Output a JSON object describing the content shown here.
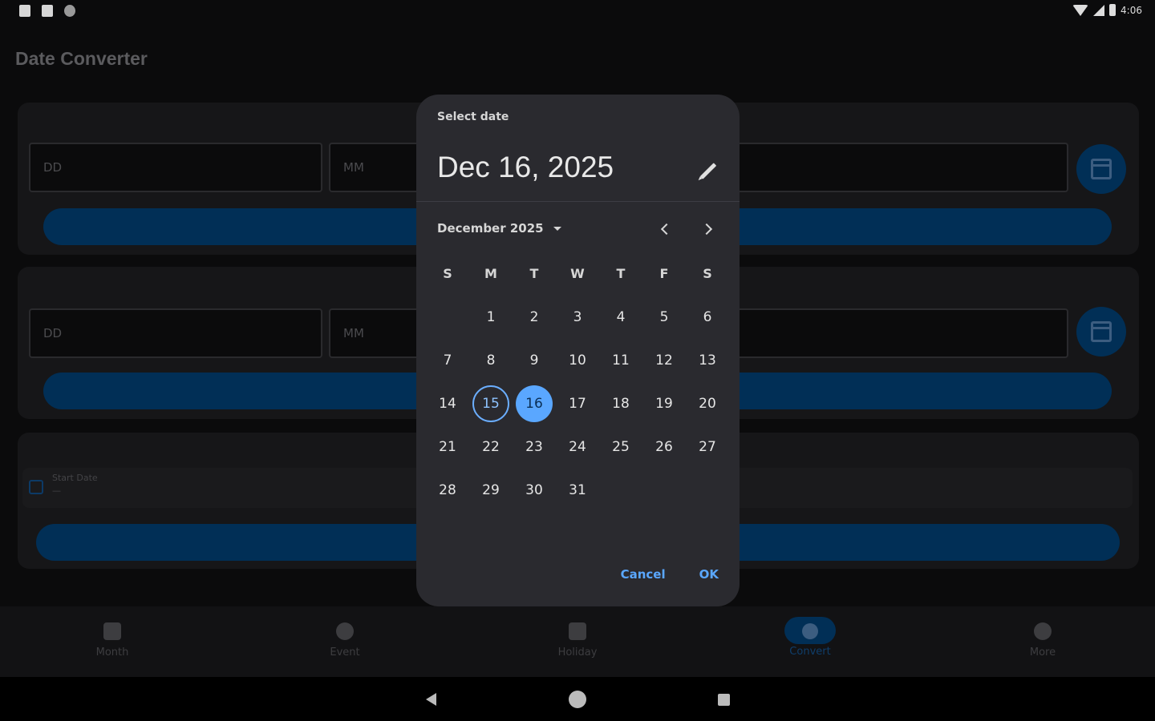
{
  "status_bar": {
    "time": "4:06",
    "icons": [
      "notification-icon",
      "sd-card-icon",
      "circle-icon",
      "wifi-icon",
      "signal-icon",
      "battery-icon"
    ]
  },
  "app_bar": {
    "title": "Date Converter"
  },
  "form": {
    "row1": {
      "day_placeholder": "DD",
      "month_placeholder": "MM"
    },
    "row2": {
      "day_placeholder": "DD",
      "month_placeholder": "MM"
    },
    "start_date": {
      "label": "Start Date",
      "value": "—"
    }
  },
  "bottom_nav": {
    "items": [
      {
        "label": "Month",
        "icon": "calendar-icon"
      },
      {
        "label": "Event",
        "icon": "event-icon"
      },
      {
        "label": "Holiday",
        "icon": "holiday-icon"
      },
      {
        "label": "Convert",
        "icon": "convert-icon",
        "active": true
      },
      {
        "label": "More",
        "icon": "gear-icon"
      }
    ]
  },
  "dialog": {
    "headline": "Select date",
    "selected_date": "Dec 16, 2025",
    "month_year": "December 2025",
    "days_of_week": [
      "S",
      "M",
      "T",
      "W",
      "T",
      "F",
      "S"
    ],
    "weeks": [
      [
        "",
        "1",
        "2",
        "3",
        "4",
        "5",
        "6"
      ],
      [
        "7",
        "8",
        "9",
        "10",
        "11",
        "12",
        "13"
      ],
      [
        "14",
        "15",
        "16",
        "17",
        "18",
        "19",
        "20"
      ],
      [
        "21",
        "22",
        "23",
        "24",
        "25",
        "26",
        "27"
      ],
      [
        "28",
        "29",
        "30",
        "31",
        "",
        "",
        ""
      ]
    ],
    "today": "15",
    "selected": "16",
    "cancel_label": "Cancel",
    "ok_label": "OK"
  },
  "colors": {
    "accent": "#5aa7ff",
    "surface": "#2a2a2f",
    "background": "#0b0b0c",
    "primary_container": "#012f56"
  }
}
